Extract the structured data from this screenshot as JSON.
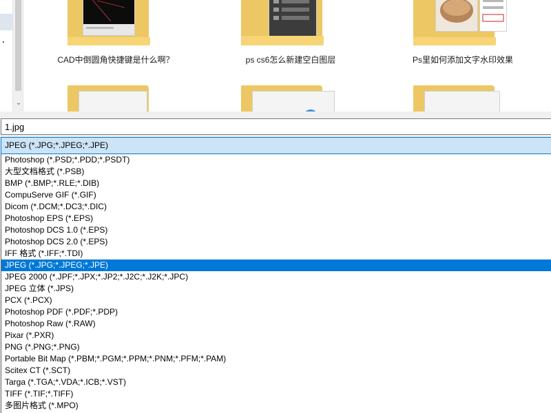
{
  "folders": {
    "row1": [
      {
        "label": "CAD中倒圆角快捷键是什么啊？"
      },
      {
        "label": "ps cs6怎么新建空白图层"
      },
      {
        "label": "Ps里如何添加文字水印效果"
      }
    ]
  },
  "filename": {
    "value": "1.jpg"
  },
  "filetype": {
    "selected": "JPEG (*.JPG;*.JPEG;*.JPE)",
    "options": [
      "Photoshop (*.PSD;*.PDD;*.PSDT)",
      "大型文档格式 (*.PSB)",
      "BMP (*.BMP;*.RLE;*.DIB)",
      "CompuServe GIF (*.GIF)",
      "Dicom (*.DCM;*.DC3;*.DIC)",
      "Photoshop EPS (*.EPS)",
      "Photoshop DCS 1.0 (*.EPS)",
      "Photoshop DCS 2.0 (*.EPS)",
      "IFF 格式 (*.IFF;*.TDI)",
      "JPEG (*.JPG;*.JPEG;*.JPE)",
      "JPEG 2000 (*.JPF;*.JPX;*.JP2;*.J2C;*.J2K;*.JPC)",
      "JPEG 立体 (*.JPS)",
      "PCX (*.PCX)",
      "Photoshop PDF (*.PDF;*.PDP)",
      "Photoshop Raw (*.RAW)",
      "Pixar (*.PXR)",
      "PNG (*.PNG;*.PNG)",
      "Portable Bit Map (*.PBM;*.PGM;*.PPM;*.PNM;*.PFM;*.PAM)",
      "Scitex CT (*.SCT)",
      "Targa (*.TGA;*.VDA;*.ICB;*.VST)",
      "TIFF (*.TIF;*.TIFF)",
      "多图片格式 (*.MPO)"
    ],
    "active_option": "JPEG (*.JPG;*.JPEG;*.JPE)"
  },
  "colors": {
    "highlight": "#0078d7",
    "selected_bg": "#cce4f7",
    "folder": "#f7d476"
  }
}
